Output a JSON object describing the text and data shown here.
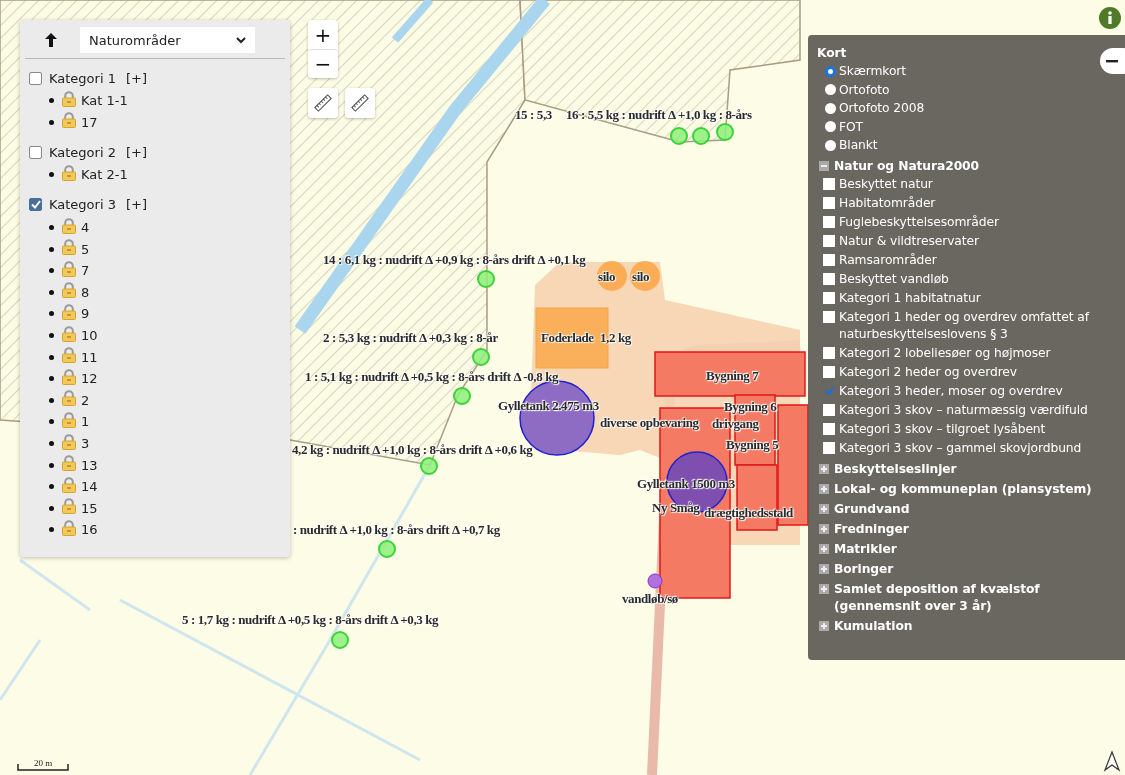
{
  "layer_panel": {
    "select": {
      "value": "Naturområder"
    },
    "categories": [
      {
        "label": "Kategori 1",
        "checked": false,
        "toggle": "[+]",
        "items": [
          "Kat 1-1",
          "17"
        ]
      },
      {
        "label": "Kategori 2",
        "checked": false,
        "toggle": "[+]",
        "items": [
          "Kat 2-1"
        ]
      },
      {
        "label": "Kategori 3",
        "checked": true,
        "toggle": "[+]",
        "items": [
          "4",
          "5",
          "7",
          "8",
          "9",
          "10",
          "11",
          "12",
          "2",
          "1",
          "3",
          "13",
          "14",
          "15",
          "16"
        ]
      }
    ]
  },
  "zoom_controls": {
    "zoom_in": "+",
    "zoom_out": "−"
  },
  "map_labels": [
    "15 : 5,3",
    "16 : 5,5 kg : nudrift Δ +1,0 kg : 8-års",
    "14 : 6,1 kg : nudrift Δ +0,9 kg : 8-års drift Δ +0,1 kg",
    "silo",
    "silo",
    "2 : 5,3 kg : nudrift Δ +0,3 kg : 8-år",
    "Foderlade",
    "1,2 kg",
    "1 : 5,1 kg : nudrift Δ +0,5 kg : 8-års drift Δ -0,8 kg",
    "Bygning 7",
    "Gylletank 2.475 m3",
    "Bygning 6",
    "diverse opbevaring",
    "drivgang",
    "Bygning 5",
    "4,2 kg : nudrift Δ +1,0 kg : 8-års drift Δ +0,6 kg",
    "Gylletank 1500 m3",
    "Ny Småg",
    "drægtighedsstald",
    ": nudrift Δ +1,0 kg : 8-års drift Δ +0,7 kg",
    "vandløb/sø",
    "5 : 1,7 kg : nudrift Δ +0,5 kg : 8-års drift Δ +0,3 kg"
  ],
  "scale_bar": "20 m",
  "basemap": {
    "title": "Kort",
    "options": [
      {
        "label": "Skærmkort",
        "selected": true
      },
      {
        "label": "Ortofoto",
        "selected": false
      },
      {
        "label": "Ortofoto 2008",
        "selected": false
      },
      {
        "label": "FOT",
        "selected": false
      },
      {
        "label": "Blankt",
        "selected": false
      }
    ]
  },
  "layer_groups": [
    {
      "title": "Natur og Natura2000",
      "expanded": true,
      "items": [
        {
          "label": "Beskyttet natur",
          "checked": false
        },
        {
          "label": "Habitatområder",
          "checked": false
        },
        {
          "label": "Fuglebeskyttelsesområder",
          "checked": false
        },
        {
          "label": "Natur & vildtreservater",
          "checked": false
        },
        {
          "label": "Ramsarområder",
          "checked": false
        },
        {
          "label": "Beskyttet vandløb",
          "checked": false
        },
        {
          "label": "Kategori 1 habitatnatur",
          "checked": false
        },
        {
          "label": "Kategori 1 heder og overdrev omfattet af naturbeskyttelseslovens § 3",
          "checked": false
        },
        {
          "label": "Kategori 2 lobeliesøer og højmoser",
          "checked": false
        },
        {
          "label": "Kategori 2 heder og overdrev",
          "checked": false
        },
        {
          "label": "Kategori 3 heder, moser og overdrev",
          "checked": true
        },
        {
          "label": "Kategori 3 skov – naturmæssig værdifuld",
          "checked": false
        },
        {
          "label": "Kategori 3 skov – tilgroet lysåbent",
          "checked": false
        },
        {
          "label": "Kategori 3 skov – gammel skovjordbund",
          "checked": false
        }
      ]
    },
    {
      "title": "Beskyttelseslinjer",
      "expanded": false
    },
    {
      "title": "Lokal- og kommuneplan (plansystem)",
      "expanded": false
    },
    {
      "title": "Grundvand",
      "expanded": false
    },
    {
      "title": "Fredninger",
      "expanded": false
    },
    {
      "title": "Matrikler",
      "expanded": false
    },
    {
      "title": "Boringer",
      "expanded": false
    },
    {
      "title": "Samlet deposition af kvælstof (gennemsnit over 3 år)",
      "expanded": false
    },
    {
      "title": "Kumulation",
      "expanded": false
    }
  ]
}
